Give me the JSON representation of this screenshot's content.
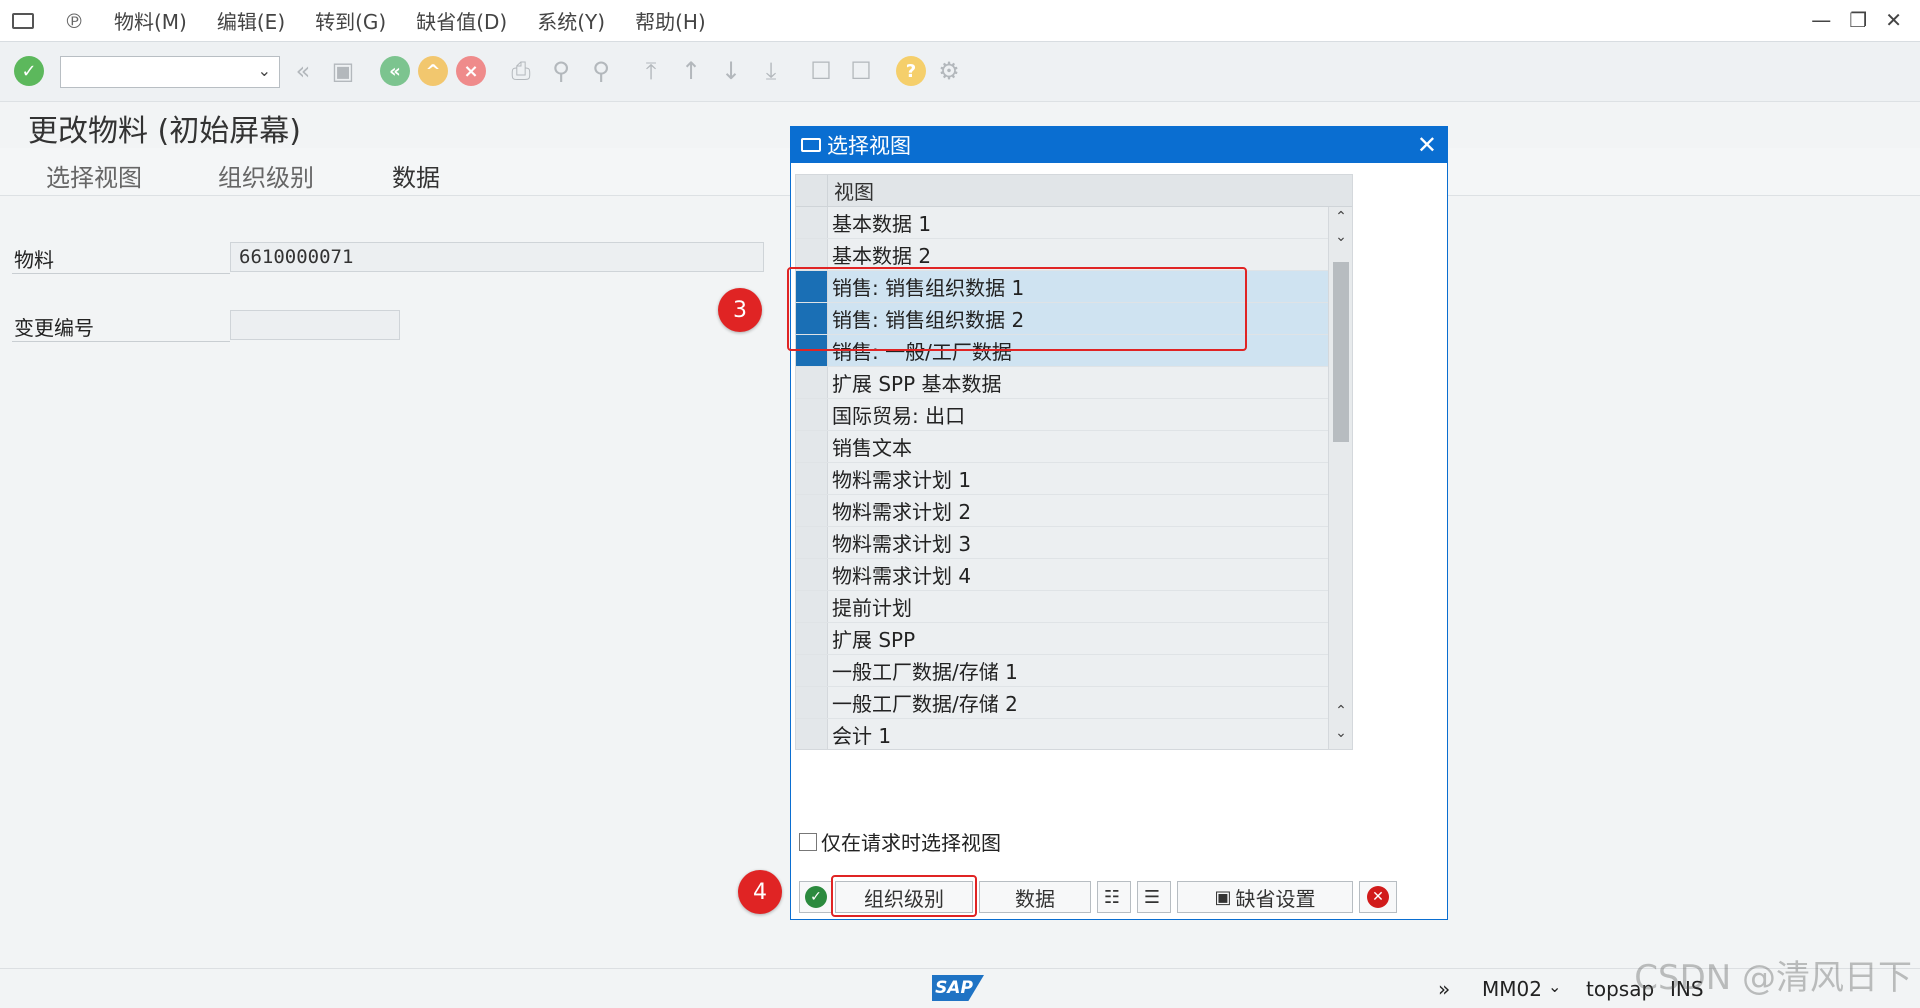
{
  "menu": {
    "items": [
      "物料(M)",
      "编辑(E)",
      "转到(G)",
      "缺省值(D)",
      "系统(Y)",
      "帮助(H)"
    ],
    "window_controls": [
      "—",
      "❐",
      "✕"
    ]
  },
  "toolbar": {
    "command_field_value": ""
  },
  "screen": {
    "title": "更改物料 (初始屏幕)",
    "app_buttons": [
      "选择视图",
      "组织级别",
      "数据"
    ]
  },
  "fields": {
    "material_label": "物料",
    "material_value": "6610000071",
    "change_no_label": "变更编号",
    "change_no_value": ""
  },
  "badges": {
    "b3": "3",
    "b4": "4"
  },
  "dialog": {
    "title": "选择视图",
    "column_header": "视图",
    "rows": [
      {
        "label": "基本数据 1",
        "selected": false
      },
      {
        "label": "基本数据 2",
        "selected": false
      },
      {
        "label": "销售: 销售组织数据 1",
        "selected": true
      },
      {
        "label": "销售: 销售组织数据 2",
        "selected": true
      },
      {
        "label": "销售: 一般/工厂数据",
        "selected": true
      },
      {
        "label": "扩展 SPP 基本数据",
        "selected": false
      },
      {
        "label": "国际贸易: 出口",
        "selected": false
      },
      {
        "label": "销售文本",
        "selected": false
      },
      {
        "label": "物料需求计划 1",
        "selected": false
      },
      {
        "label": "物料需求计划 2",
        "selected": false
      },
      {
        "label": "物料需求计划 3",
        "selected": false
      },
      {
        "label": "物料需求计划 4",
        "selected": false
      },
      {
        "label": "提前计划",
        "selected": false
      },
      {
        "label": "扩展 SPP",
        "selected": false
      },
      {
        "label": "一般工厂数据/存储 1",
        "selected": false
      },
      {
        "label": "一般工厂数据/存储 2",
        "selected": false
      },
      {
        "label": "会计 1",
        "selected": false
      }
    ],
    "checkbox_label": "仅在请求时选择视图",
    "checkbox_checked": false,
    "buttons": {
      "org_levels": "组织级别",
      "data": "数据",
      "default_settings": "缺省设置"
    }
  },
  "status": {
    "transaction": "MM02",
    "system": "topsap",
    "mode": "INS",
    "logo": "SAP"
  },
  "watermark": "CSDN @清风日下",
  "colors": {
    "accent": "#0a6ed1",
    "highlight": "#e02424",
    "selected_row": "#cfe3f1"
  }
}
